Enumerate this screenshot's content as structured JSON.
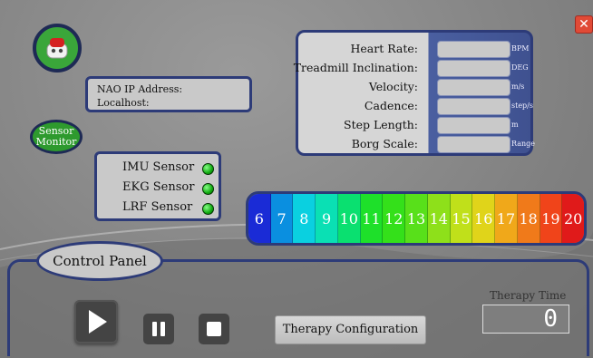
{
  "window": {
    "close_glyph": "✕"
  },
  "robot": {
    "icon": "robot-head-icon"
  },
  "connection": {
    "ip_label": "NAO IP Address:",
    "host_label": "Localhost:"
  },
  "sensor_monitor": {
    "title_line1": "Sensor",
    "title_line2": "Monitor",
    "sensors": [
      {
        "label": "IMU Sensor",
        "status_color": "#22aa22"
      },
      {
        "label": "EKG Sensor",
        "status_color": "#22aa22"
      },
      {
        "label": "LRF Sensor",
        "status_color": "#22aa22"
      }
    ]
  },
  "vitals": [
    {
      "label": "Heart Rate:",
      "value": "",
      "unit": "BPM"
    },
    {
      "label": "Treadmill Inclination:",
      "value": "",
      "unit": "DEG"
    },
    {
      "label": "Velocity:",
      "value": "",
      "unit": "m/s"
    },
    {
      "label": "Cadence:",
      "value": "",
      "unit": "step/s"
    },
    {
      "label": "Step Length:",
      "value": "",
      "unit": "m"
    },
    {
      "label": "Borg Scale:",
      "value": "",
      "unit": "Range"
    }
  ],
  "borg_scale": {
    "values": [
      "6",
      "7",
      "8",
      "9",
      "10",
      "11",
      "12",
      "13",
      "14",
      "15",
      "16",
      "17",
      "18",
      "19",
      "20"
    ],
    "colors": [
      "#1a2bd6",
      "#0a8fe0",
      "#0ad0e0",
      "#0ae0b4",
      "#0ae070",
      "#1ee02a",
      "#34e01a",
      "#58e01a",
      "#8ee01a",
      "#c0e01a",
      "#e0d41a",
      "#f0a81a",
      "#f07a1a",
      "#f0441a",
      "#e01a1a"
    ]
  },
  "control_panel": {
    "title": "Control Panel",
    "play_icon": "play-icon",
    "pause_icon": "pause-icon",
    "stop_icon": "stop-icon",
    "config_button": "Therapy Configuration",
    "therapy_time_label": "Therapy Time",
    "therapy_time_value": "0"
  }
}
